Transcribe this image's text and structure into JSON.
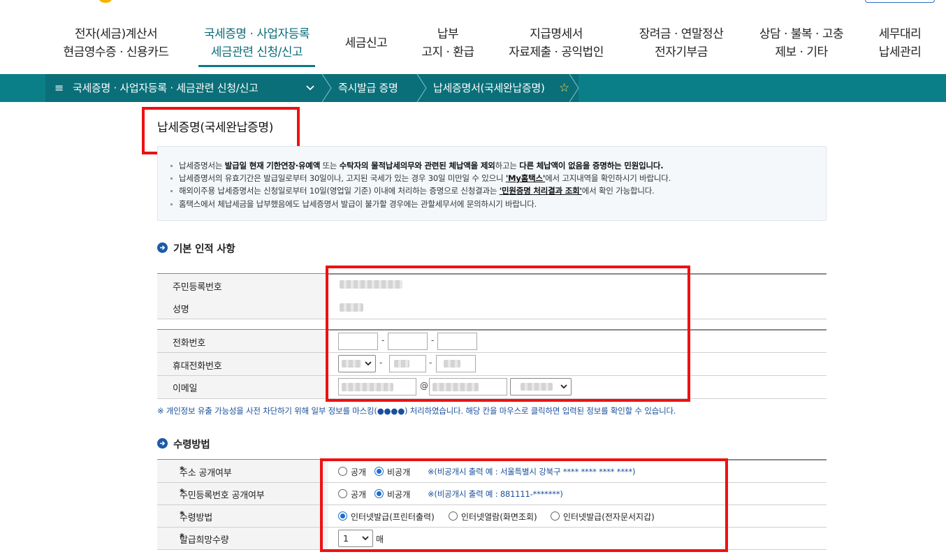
{
  "nav": [
    {
      "line1": "전자(세금)계산서",
      "line2": "현금영수증 · 신용카드"
    },
    {
      "line1": "국세증명 · 사업자등록",
      "line2": "세금관련 신청/신고"
    },
    {
      "line1": "세금신고",
      "line2": ""
    },
    {
      "line1": "납부",
      "line2": "고지 · 환급"
    },
    {
      "line1": "지급명세서",
      "line2": "자료제출 · 공익법인"
    },
    {
      "line1": "장려금 · 연말정산",
      "line2": "전자기부금"
    },
    {
      "line1": "상담 · 불복 · 고충",
      "line2": "제보 · 기타"
    },
    {
      "line1": "세무대리",
      "line2": "납세관리"
    }
  ],
  "breadcrumb": {
    "menu_icon": "≡",
    "level1": "국세증명 · 사업자등록 · 세금관련 신청/신고",
    "level2": "즉시발급 증명",
    "level3": "납세증명서(국세완납증명)",
    "star": "☆"
  },
  "page": {
    "title": "납세증명(국세완납증명)"
  },
  "info": {
    "l1_a": "납세증명서는 ",
    "l1_b": "발급일 현재 기한연장·유예액",
    "l1_c": " 또는 ",
    "l1_d": "수탁자의 물적납세의무와 관련된 체납액을 제외",
    "l1_e": "하고는 ",
    "l1_f": "다른 체납액이 없음을 증명하는 민원입니다.",
    "l2_a": "납세증명서의 유효기간은 발급일로부터 30일이나, 고지된 국세가 있는 경우 30일 미만일 수 있으니 ",
    "l2_link": "'My홈택스'",
    "l2_b": "에서 고지내역을 확인하시기 바랍니다.",
    "l3_a": "해외이주용 납세증명서는 신청일로부터 10일(영업일 기준) 이내에 처리하는 증명으로 신청결과는 ",
    "l3_link": "'민원증명 처리결과 조회'",
    "l3_b": "에서 확인 가능합니다.",
    "l4": "홈택스에서 체납세금을 납부했음에도 납세증명서 발급이 불가할 경우에는 관할세무서에 문의하시기 바랍니다."
  },
  "basic": {
    "section_title": "기본 인적 사항",
    "rrn_label": "주민등록번호",
    "name_label": "성명",
    "phone_label": "전화번호",
    "mobile_label": "휴대전화번호",
    "email_label": "이메일",
    "dash": "-",
    "at": "@"
  },
  "mask_note": "※ 개인정보 유출 가능성을 사전 차단하기 위해 일부 정보를 마스킹(●●●●) 처리하였습니다. 해당 칸을 마우스로 클릭하면 입력된 정보를 확인할 수 있습니다.",
  "receive": {
    "section_title": "수령방법",
    "req_mark": "*",
    "address_label": "주소 공개여부",
    "rrn_public_label": "주민등록번호 공개여부",
    "method_label": "수령방법",
    "qty_label": "발급희망수량",
    "public": "공개",
    "private": "비공개",
    "address_hint": "※(비공개시 출력 예 : 서울특별시 강북구 **** **** **** ****)",
    "rrn_hint": "※(비공개시 출력 예 : 881111-*******)",
    "method_opt1": "인터넷발급(프린터출력)",
    "method_opt2": "인터넷열람(화면조회)",
    "method_opt3": "인터넷발급(전자문서지갑)",
    "qty_value": "1",
    "qty_unit": "매"
  }
}
